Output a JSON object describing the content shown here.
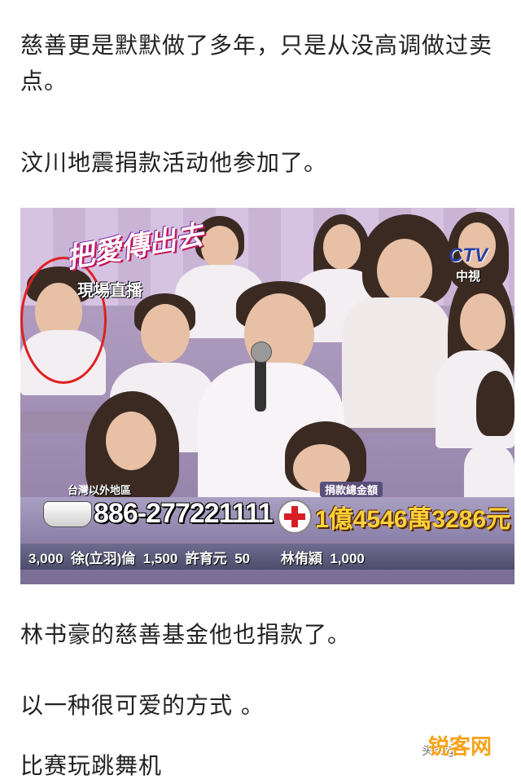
{
  "article": {
    "paragraph_1": "慈善更是默默做了多年，只是从没高调做过卖点。",
    "paragraph_2": "汶川地震捐款活动他参加了。",
    "paragraph_3": "林书豪的慈善基金他也捐款了。",
    "paragraph_4": "以一种很可爱的方式 。",
    "paragraph_5": "比赛玩跳舞机"
  },
  "tv_screenshot": {
    "show_logo": "把愛傳出去",
    "live_badge": "現場直播",
    "channel_logo": "CTV",
    "channel_name": "中視",
    "hotline_label": "台灣以外地區",
    "hotline_number": "886-277221111",
    "total_label": "捐款總金額",
    "total_amount": "1億4546萬3286元",
    "ticker": "3,000  徐(立羽)倫  1,500  許育元  50        林侑潁  1,000"
  },
  "watermark": {
    "source_text": "头条@",
    "site_text": "锐客网"
  },
  "colors": {
    "text": "#222222",
    "highlight_circle": "#e02020",
    "amount_yellow": "#ffd23a",
    "watermark_orange": "#f7a21b"
  }
}
